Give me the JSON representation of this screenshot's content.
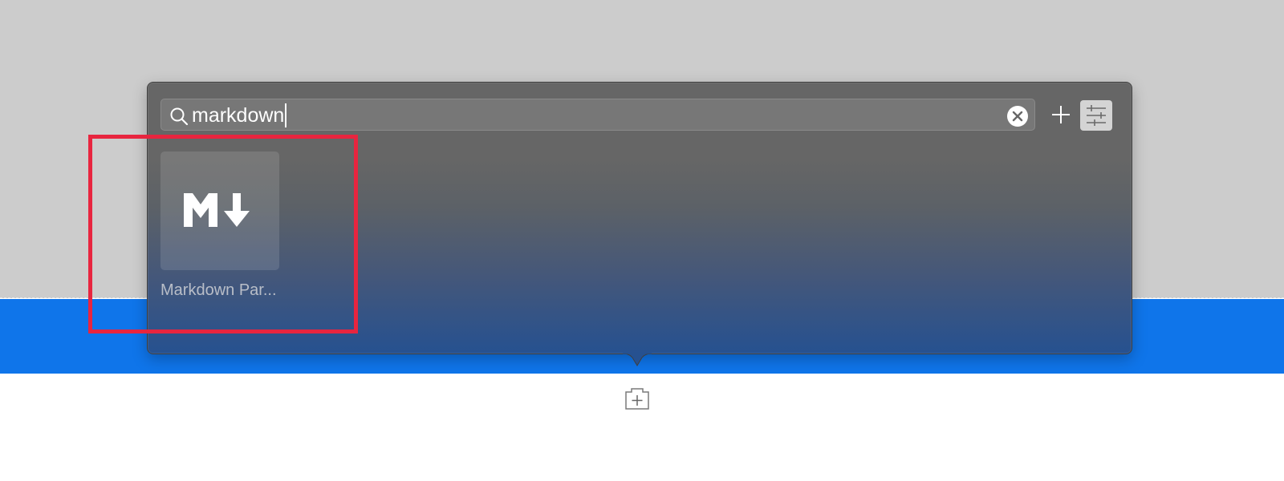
{
  "search": {
    "value": "markdown"
  },
  "results": [
    {
      "label": "Markdown Par..."
    }
  ],
  "icons": {
    "search": "search-icon",
    "clear": "close-circle-icon",
    "add": "plus-icon",
    "filter": "sliders-icon",
    "result": "markdown-icon",
    "add_block": "add-block-icon"
  },
  "colors": {
    "canvas_top": "#cccccc",
    "canvas_band": "#0f75ea",
    "highlight": "#e8253f"
  }
}
